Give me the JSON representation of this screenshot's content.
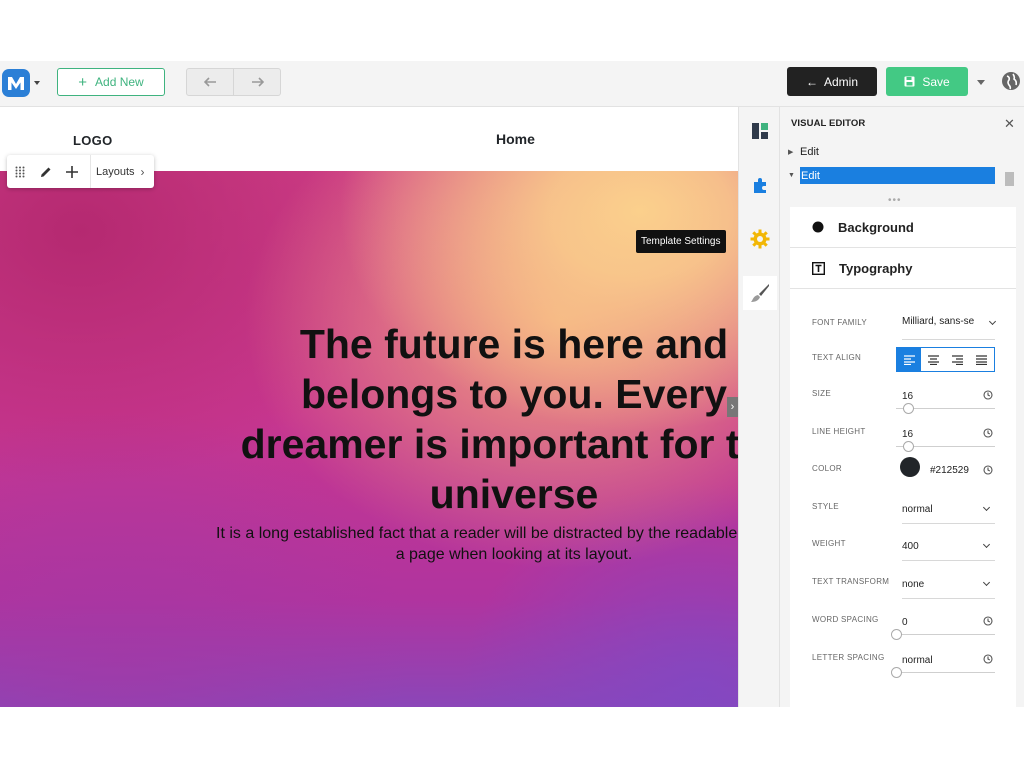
{
  "toolbar": {
    "add_new_label": "Add New",
    "admin_label": "Admin",
    "save_label": "Save"
  },
  "canvas": {
    "site_logo": "LOGO",
    "nav_home": "Home",
    "row_toolbar_layouts": "Layouts",
    "tooltip": "Template Settings",
    "hero_title": "The future is here and belongs to you. Every dreamer is important for the universe",
    "hero_text": "It is a long established fact that a reader will be distracted by the readable content of a page when looking at its layout."
  },
  "rail": {
    "items": [
      "layers-icon",
      "puzzle-icon",
      "gear-icon",
      "paintbrush-icon"
    ],
    "active": "paintbrush-icon"
  },
  "panel": {
    "title": "VISUAL EDITOR",
    "tree": [
      {
        "label": "Edit",
        "expanded": false,
        "selected": false
      },
      {
        "label": "Edit",
        "expanded": true,
        "selected": true
      }
    ],
    "sections": {
      "background": "Background",
      "typography": "Typography"
    },
    "controls": {
      "font_family": {
        "label": "FONT FAMILY",
        "value": "Milliard, sans-se"
      },
      "text_align": {
        "label": "TEXT ALIGN",
        "value": "left"
      },
      "size": {
        "label": "SIZE",
        "value": "16",
        "slider": 0.12
      },
      "line_height": {
        "label": "LINE HEIGHT",
        "value": "16",
        "slider": 0.12
      },
      "color": {
        "label": "COLOR",
        "value": "#212529"
      },
      "style": {
        "label": "STYLE",
        "value": "normal"
      },
      "weight": {
        "label": "WEIGHT",
        "value": "400"
      },
      "text_transform": {
        "label": "TEXT TRANSFORM",
        "value": "none"
      },
      "word_spacing": {
        "label": "WORD SPACING",
        "value": "0",
        "slider": 0.0
      },
      "letter_spacing": {
        "label": "LETTER SPACING",
        "value": "normal",
        "slider": 0.0
      }
    }
  },
  "colors": {
    "accent_blue": "#1a7fe0",
    "save_green": "#43c984",
    "add_new_green": "#3fb37f",
    "admin_dark": "#222222",
    "swatch": "#212529"
  }
}
